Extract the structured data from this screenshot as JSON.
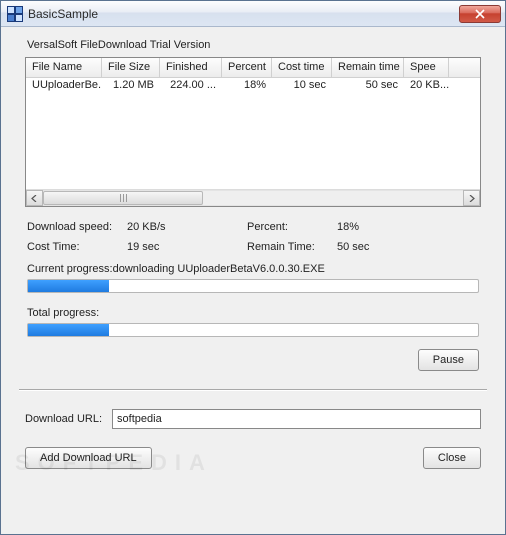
{
  "window": {
    "title": "BasicSample",
    "close_label": "Close window"
  },
  "subtitle": "VersalSoft FileDownload Trial Version",
  "table": {
    "headers": [
      "File Name",
      "File Size",
      "Finished",
      "Percent",
      "Cost time",
      "Remain time",
      "Spee"
    ],
    "rows": [
      {
        "cells": [
          "UUploaderBe...",
          "1.20 MB",
          "224.00 ...",
          "18%",
          "10 sec",
          "50 sec",
          "20 KB..."
        ]
      }
    ]
  },
  "stats": {
    "download_speed_label": "Download speed:",
    "download_speed_value": "20 KB/s",
    "percent_label": "Percent:",
    "percent_value": "18%",
    "cost_time_label": "Cost Time:",
    "cost_time_value": "19 sec",
    "remain_time_label": "Remain Time:",
    "remain_time_value": "50 sec"
  },
  "current_progress": {
    "label": "Current progress:downloading UUploaderBetaV6.0.0.30.EXE",
    "percent": 18
  },
  "total_progress": {
    "label": "Total progress:",
    "percent": 18
  },
  "buttons": {
    "pause": "Pause",
    "add_url": "Add Download URL",
    "close": "Close"
  },
  "url": {
    "label": "Download URL:",
    "value": "softpedia"
  },
  "watermark": "SOFTPEDIA"
}
